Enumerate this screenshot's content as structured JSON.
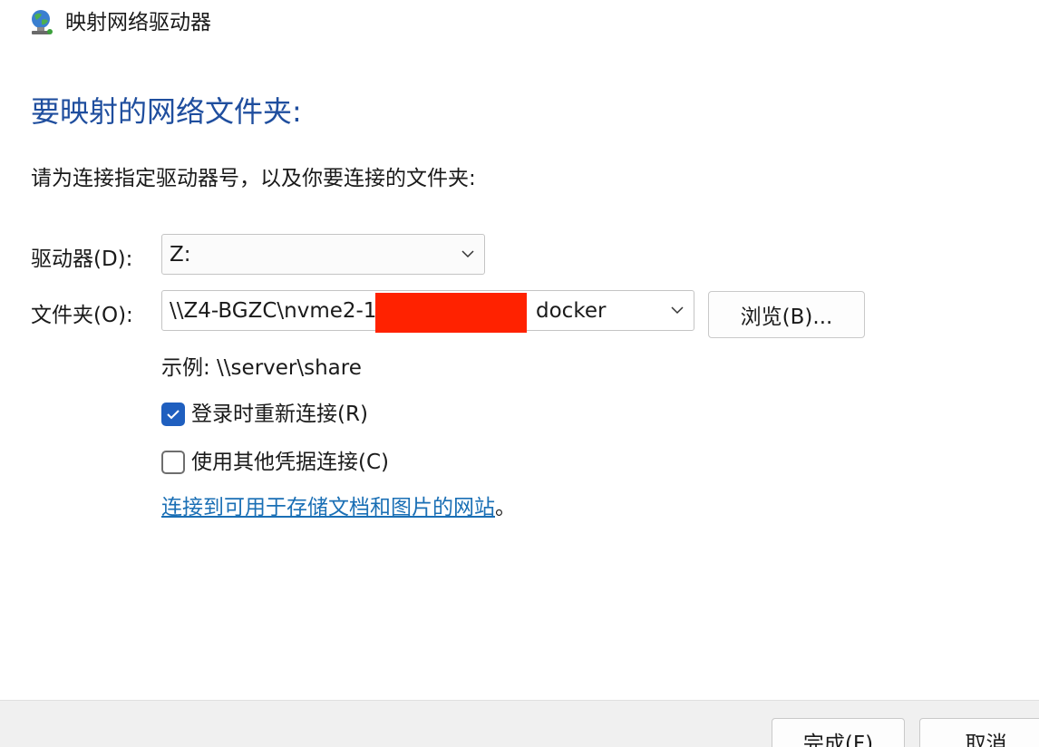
{
  "window": {
    "title": "映射网络驱动器",
    "icon": "network-drive-icon"
  },
  "heading": "要映射的网络文件夹:",
  "instruction": "请为连接指定驱动器号，以及你要连接的文件夹:",
  "drive": {
    "label": "驱动器(D):",
    "value": "Z:"
  },
  "folder": {
    "label": "文件夹(O):",
    "value": "\\\\Z4-BGZC\\nvme2-1",
    "value_tail": "docker"
  },
  "browse_button": "浏览(B)...",
  "example": "示例: \\\\server\\share",
  "reconnect": {
    "label": "登录时重新连接(R)",
    "checked": true
  },
  "credentials": {
    "label": "使用其他凭据连接(C)",
    "checked": false
  },
  "link": {
    "text": "连接到可用于存储文档和图片的网站",
    "suffix": "。"
  },
  "footer": {
    "finish": "完成(F)",
    "cancel": "取消"
  },
  "colors": {
    "heading": "#1f4e9e",
    "link": "#1a6fb5",
    "checkbox_checked": "#1f5fbf",
    "redaction": "#ff2200"
  }
}
